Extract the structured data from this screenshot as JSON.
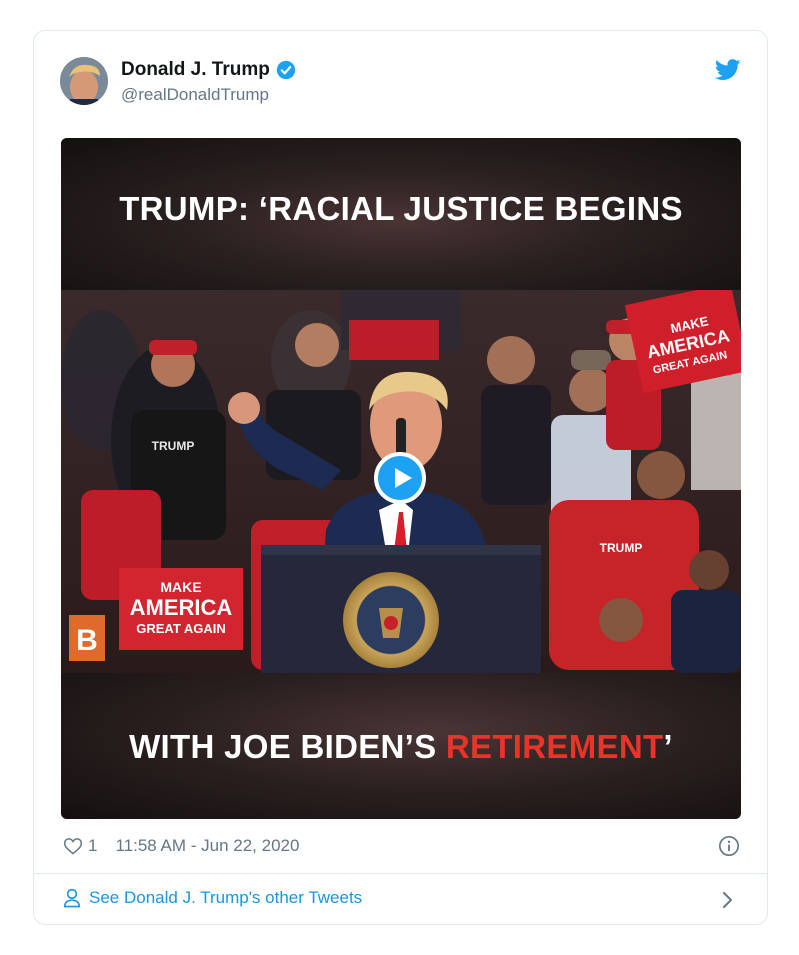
{
  "tweet": {
    "author_name": "Donald J. Trump",
    "handle": "@realDonaldTrump",
    "likes": "1",
    "timestamp": "11:58 AM - Jun 22, 2020"
  },
  "media": {
    "caption_top": "TRUMP: ‘RACIAL JUSTICE BEGINS",
    "caption_bottom_white": "WITH JOE BIDEN’S ",
    "caption_bottom_red": "RETIREMENT",
    "caption_bottom_end": "’",
    "crowd_sign_left_1": "MAKE",
    "crowd_sign_left_2": "AMERICA",
    "crowd_sign_left_3": "GREAT AGAIN",
    "crowd_sign_right_1": "MAKE",
    "crowd_sign_right_2": "AMERICA",
    "crowd_sign_right_3": "GREAT AGAIN",
    "shirt_text_left": "TRUMP",
    "shirt_text_right": "TRUMP",
    "brand_badge": "B"
  },
  "footer": {
    "link_text": "See Donald J. Trump's other Tweets"
  },
  "icons": {
    "verified": "verified-badge-icon",
    "bird": "twitter-bird-icon",
    "heart": "heart-icon",
    "info": "info-icon",
    "user": "user-icon",
    "chevron": "chevron-right-icon",
    "play": "play-icon"
  },
  "colors": {
    "twitter_blue": "#1da1f2",
    "link_blue": "#1b95e0",
    "caption_red": "#e8342a",
    "muted_text": "#657786"
  }
}
